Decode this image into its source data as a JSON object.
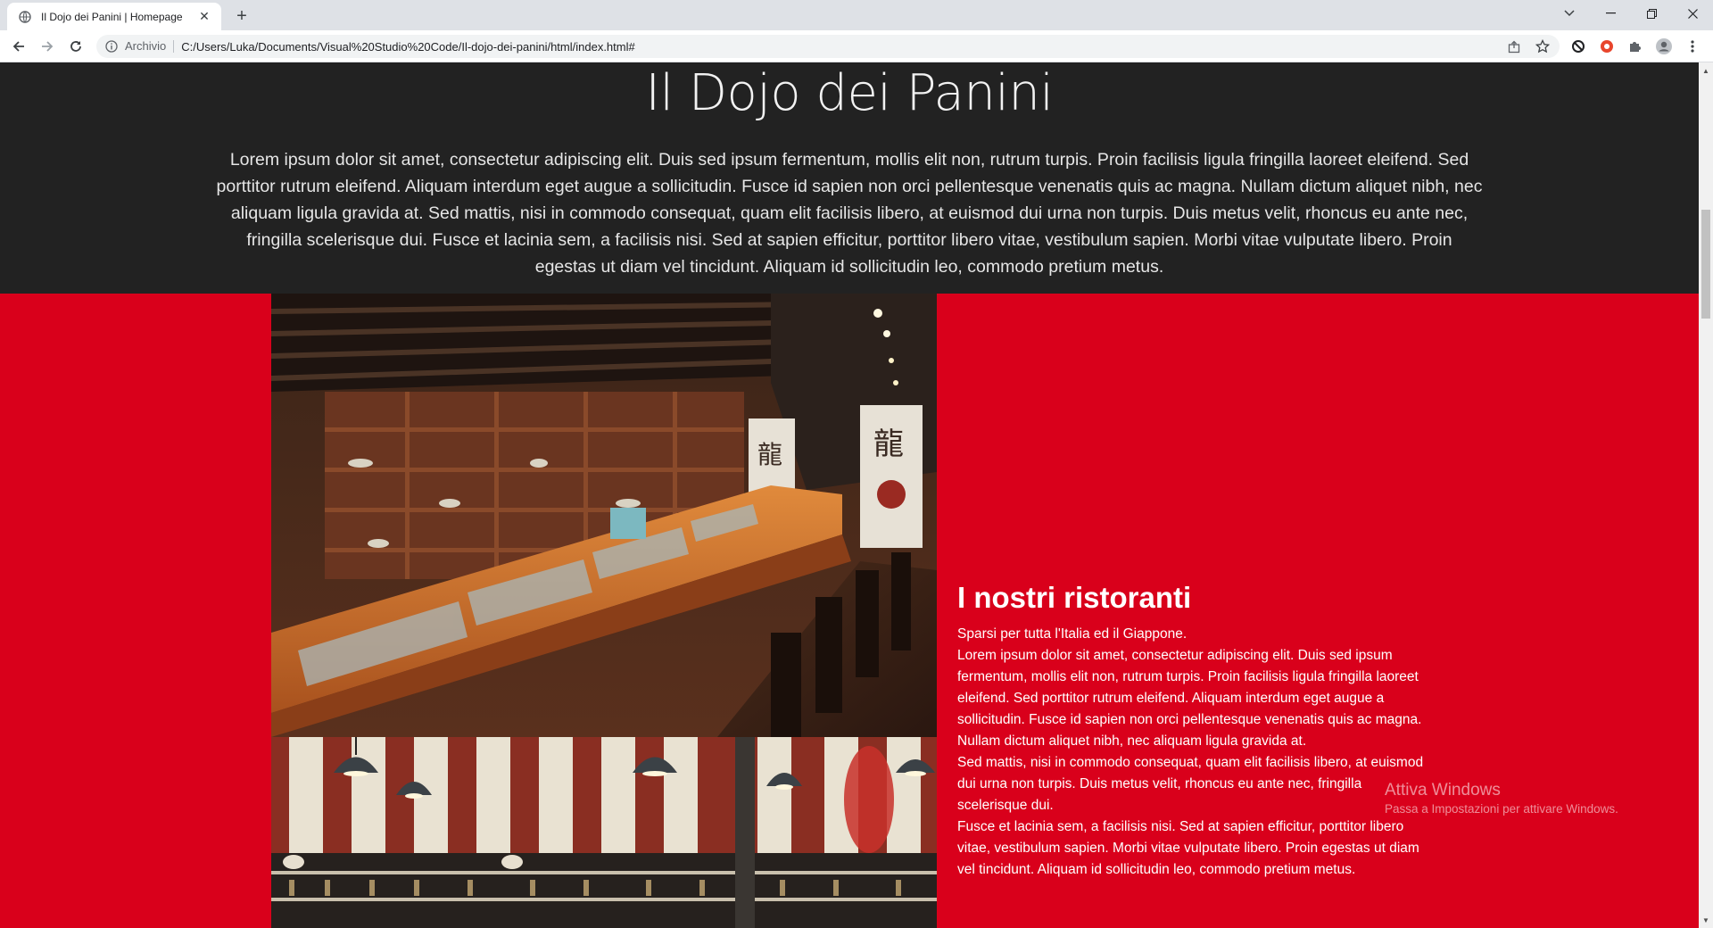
{
  "browser": {
    "tab_title": "Il Dojo dei Panini | Homepage",
    "tab_close": "✕",
    "new_tab": "+",
    "omnibox_scheme": "Archivio",
    "omnibox_url": "C:/Users/Luka/Documents/Visual%20Studio%20Code/Il-dojo-dei-panini/html/index.html#"
  },
  "hero": {
    "title": "Il Dojo dei Panini",
    "text": "Lorem ipsum dolor sit amet, consectetur adipiscing elit. Duis sed ipsum fermentum, mollis elit non, rutrum turpis. Proin facilisis ligula fringilla laoreet eleifend. Sed porttitor rutrum eleifend. Aliquam interdum eget augue a sollicitudin. Fusce id sapien non orci pellentesque venenatis quis ac magna. Nullam dictum aliquet nibh, nec aliquam ligula gravida at. Sed mattis, nisi in commodo consequat, quam elit facilisis libero, at euismod dui urna non turpis. Duis metus velit, rhoncus eu ante nec, fringilla scelerisque dui. Fusce et lacinia sem, a facilisis nisi. Sed at sapien efficitur, porttitor libero vitae, vestibulum sapien. Morbi vitae vulputate libero. Proin egestas ut diam vel tincidunt. Aliquam id sollicitudin leo, commodo pretium metus."
  },
  "restaurants": {
    "title": "I nostri ristoranti",
    "subtitle": "Sparsi per tutta l'Italia ed il Giappone.",
    "para1": "Lorem ipsum dolor sit amet, consectetur adipiscing elit. Duis sed ipsum fermentum, mollis elit non, rutrum turpis. Proin facilisis ligula fringilla laoreet eleifend. Sed porttitor rutrum eleifend. Aliquam interdum eget augue a sollicitudin. Fusce id sapien non orci pellentesque venenatis quis ac magna. Nullam dictum aliquet nibh, nec aliquam ligula gravida at.",
    "para2": "Sed mattis, nisi in commodo consequat, quam elit facilisis libero, at euismod dui urna non turpis. Duis metus velit, rhoncus eu ante nec, fringilla scelerisque dui.",
    "para3": "Fusce et lacinia sem, a facilisis nisi. Sed at sapien efficitur, porttitor libero vitae, vestibulum sapien. Morbi vitae vulputate libero. Proin egestas ut diam vel tincidunt. Aliquam id sollicitudin leo, commodo pretium metus."
  },
  "watermark": {
    "line1": "Attiva Windows",
    "line2": "Passa a Impostazioni per attivare Windows."
  },
  "colors": {
    "hero_bg": "#222222",
    "section_bg": "#d9001b",
    "text": "#ffffff"
  }
}
